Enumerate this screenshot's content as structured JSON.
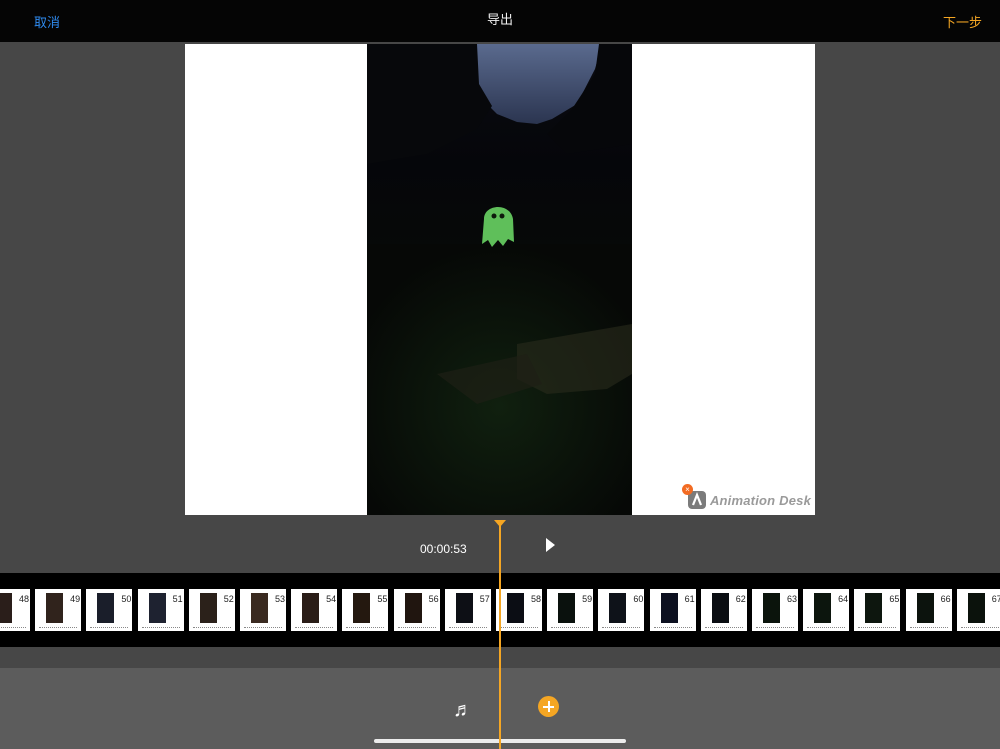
{
  "topbar": {
    "cancel_label": "取消",
    "title": "导出",
    "next_label": "下一步"
  },
  "colors": {
    "accent_blue": "#2f8bf0",
    "accent_orange": "#f5a623"
  },
  "preview": {
    "watermark_text": "Animation Desk"
  },
  "playback": {
    "timecode": "00:00:53"
  },
  "timeline": {
    "frames": [
      {
        "number": "48",
        "tone": "#2a1e1a"
      },
      {
        "number": "49",
        "tone": "#30231c"
      },
      {
        "number": "50",
        "tone": "#1a1e2a"
      },
      {
        "number": "51",
        "tone": "#1e2230"
      },
      {
        "number": "52",
        "tone": "#2b211a"
      },
      {
        "number": "53",
        "tone": "#3a2a20"
      },
      {
        "number": "54",
        "tone": "#2a1d17"
      },
      {
        "number": "55",
        "tone": "#24180f"
      },
      {
        "number": "56",
        "tone": "#20150f"
      },
      {
        "number": "57",
        "tone": "#0d0f15"
      },
      {
        "number": "58",
        "tone": "#0b0d14"
      },
      {
        "number": "59",
        "tone": "#0a110d"
      },
      {
        "number": "60",
        "tone": "#0e1219"
      },
      {
        "number": "61",
        "tone": "#0c1020"
      },
      {
        "number": "62",
        "tone": "#0a0d12"
      },
      {
        "number": "63",
        "tone": "#0b140c"
      },
      {
        "number": "64",
        "tone": "#0c150d"
      },
      {
        "number": "65",
        "tone": "#0d160e"
      },
      {
        "number": "66",
        "tone": "#0c130d"
      },
      {
        "number": "67",
        "tone": "#0b120c"
      }
    ]
  },
  "icons": {
    "music": "music-note-icon",
    "add": "plus-circle-icon",
    "play": "play-icon"
  }
}
